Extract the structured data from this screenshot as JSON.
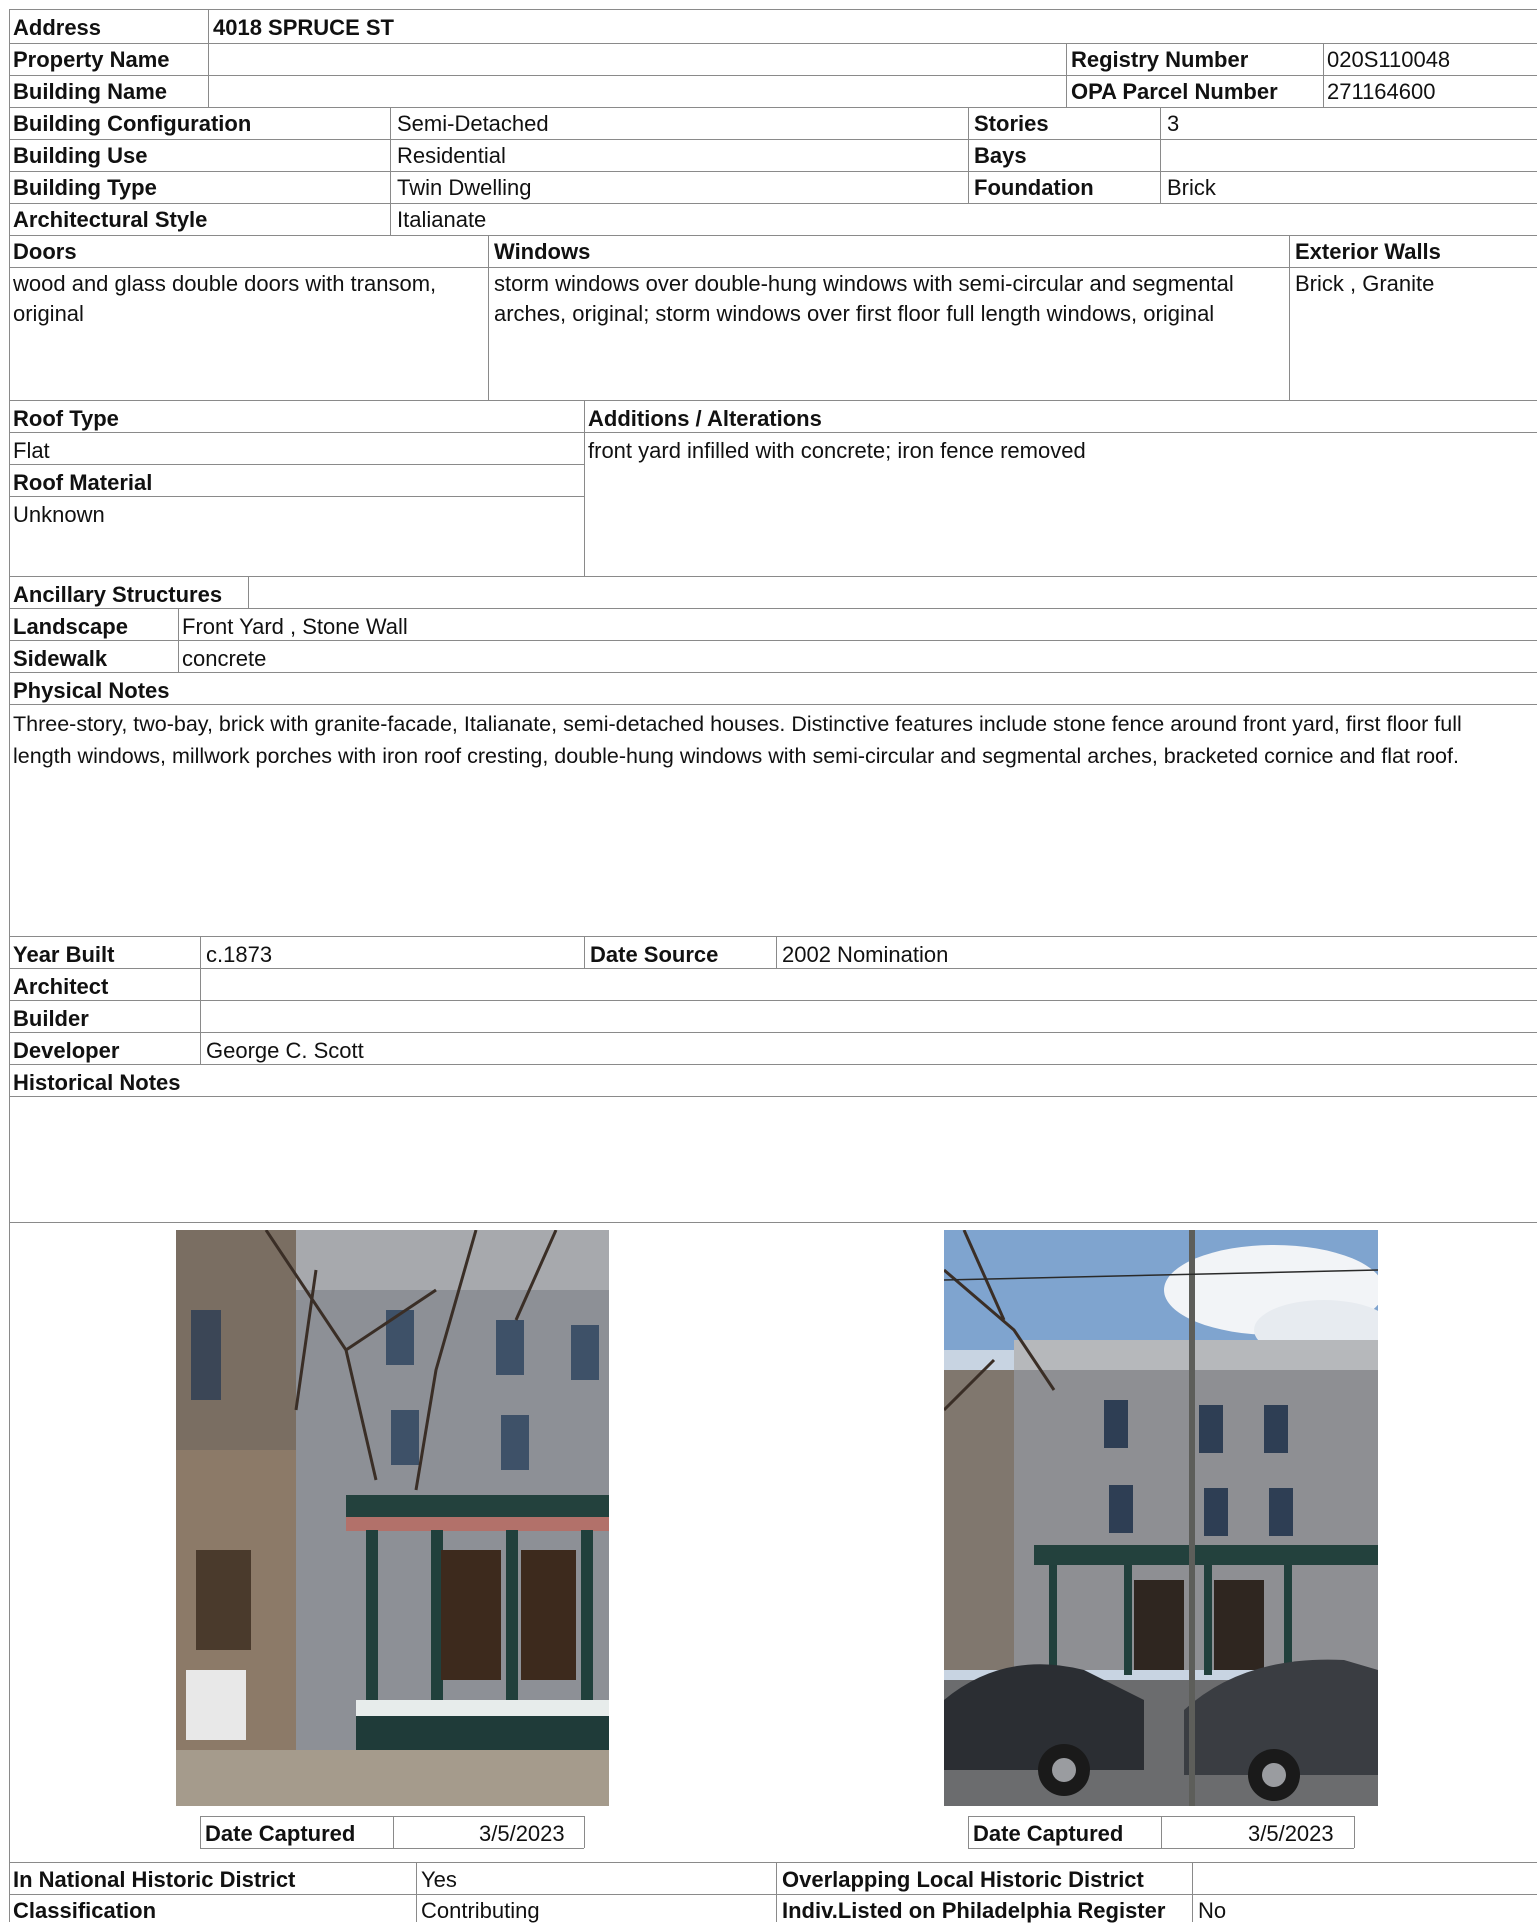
{
  "address": {
    "label": "Address",
    "value": "4018 SPRUCE ST"
  },
  "property_name": {
    "label": "Property Name",
    "value": ""
  },
  "registry_number": {
    "label": "Registry Number",
    "value": "020S110048"
  },
  "building_name": {
    "label": "Building Name",
    "value": ""
  },
  "opa_parcel_number": {
    "label": "OPA Parcel Number",
    "value": "271164600"
  },
  "building_configuration": {
    "label": "Building Configuration",
    "value": "Semi-Detached"
  },
  "stories": {
    "label": "Stories",
    "value": "3"
  },
  "building_use": {
    "label": "Building Use",
    "value": "Residential"
  },
  "bays": {
    "label": "Bays",
    "value": ""
  },
  "building_type": {
    "label": "Building Type",
    "value": "Twin Dwelling"
  },
  "foundation": {
    "label": "Foundation",
    "value": "Brick"
  },
  "architectural_style": {
    "label": "Architectural Style",
    "value": "Italianate"
  },
  "doors": {
    "label": "Doors",
    "value": "wood and glass double doors with transom, original"
  },
  "windows": {
    "label": "Windows",
    "value": "storm windows over double-hung windows with semi-circular and segmental arches, original; storm windows over first floor full length windows, original"
  },
  "exterior_walls": {
    "label": "Exterior Walls",
    "value": "Brick , Granite"
  },
  "roof_type": {
    "label": "Roof Type",
    "value": "Flat"
  },
  "roof_material": {
    "label": "Roof Material",
    "value": "Unknown"
  },
  "additions_alterations": {
    "label": "Additions / Alterations",
    "value": "front yard infilled with concrete; iron fence removed"
  },
  "ancillary_structures": {
    "label": "Ancillary Structures",
    "value": ""
  },
  "landscape": {
    "label": "Landscape",
    "value": "Front Yard , Stone Wall"
  },
  "sidewalk": {
    "label": "Sidewalk",
    "value": "concrete"
  },
  "physical_notes": {
    "label": "Physical Notes",
    "value": "Three-story, two-bay, brick with granite-facade, Italianate, semi-detached houses. Distinctive features include stone fence around front yard, first floor full length windows, millwork porches with iron roof cresting, double-hung windows with semi-circular and segmental arches, bracketed cornice and flat roof."
  },
  "year_built": {
    "label": "Year Built",
    "value": "c.1873"
  },
  "date_source": {
    "label": "Date Source",
    "value": "2002 Nomination"
  },
  "architect": {
    "label": "Architect",
    "value": ""
  },
  "builder": {
    "label": "Builder",
    "value": ""
  },
  "developer": {
    "label": "Developer",
    "value": "George C. Scott"
  },
  "historical_notes": {
    "label": "Historical Notes",
    "value": ""
  },
  "photos": [
    {
      "date_label": "Date Captured",
      "date_value": "3/5/2023"
    },
    {
      "date_label": "Date Captured",
      "date_value": "3/5/2023"
    }
  ],
  "national_historic_district": {
    "label": "In National Historic District",
    "value": "Yes"
  },
  "local_historic_district": {
    "label": "Overlapping Local Historic District",
    "value": ""
  },
  "classification": {
    "label": "Classification",
    "value": "Contributing"
  },
  "indiv_listed": {
    "label": "Indiv.Listed on Philadelphia Register",
    "value": "No"
  },
  "colors": {
    "grid": "#8a8a8a",
    "text": "#111111",
    "background": "#ffffff"
  }
}
